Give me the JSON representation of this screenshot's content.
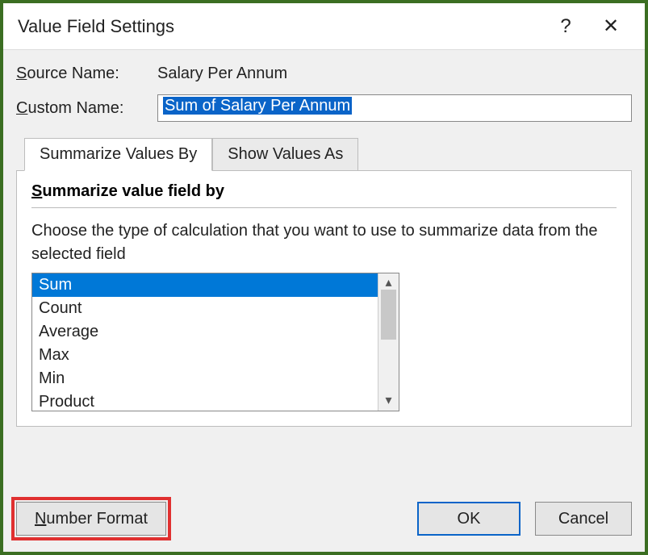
{
  "titlebar": {
    "title": "Value Field Settings",
    "help": "?",
    "close": "✕"
  },
  "source": {
    "label_pre": "S",
    "label_post": "ource Name:",
    "value": "Salary Per Annum"
  },
  "custom": {
    "label_pre": "C",
    "label_post": "ustom Name:",
    "value": "Sum of Salary Per Annum"
  },
  "tabs": {
    "summarize": "Summarize Values By",
    "show": "Show Values As"
  },
  "panel": {
    "heading_pre": "S",
    "heading_post": "ummarize value field by",
    "help": "Choose the type of calculation that you want to use to summarize data from the selected field",
    "options": [
      "Sum",
      "Count",
      "Average",
      "Max",
      "Min",
      "Product"
    ],
    "selected_index": 0
  },
  "buttons": {
    "number_pre": "N",
    "number_post": "umber Format",
    "ok": "OK",
    "cancel": "Cancel"
  }
}
